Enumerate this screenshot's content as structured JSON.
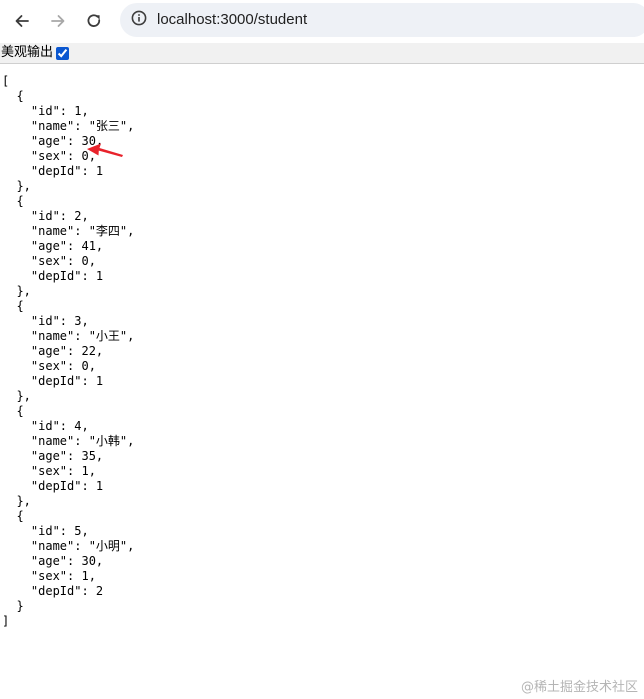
{
  "browser": {
    "url": "localhost:3000/student",
    "icons": {
      "back": "arrow-left-icon",
      "forward": "arrow-right-icon",
      "reload": "reload-icon",
      "site_info": "info-icon"
    }
  },
  "pretty_print": {
    "label": "美观输出",
    "checked": true
  },
  "json_lines": [
    "[",
    "  {",
    "    \"id\": 1,",
    "    \"name\": \"张三\",",
    "    \"age\": 30,",
    "    \"sex\": 0,",
    "    \"depId\": 1",
    "  },",
    "  {",
    "    \"id\": 2,",
    "    \"name\": \"李四\",",
    "    \"age\": 41,",
    "    \"sex\": 0,",
    "    \"depId\": 1",
    "  },",
    "  {",
    "    \"id\": 3,",
    "    \"name\": \"小王\",",
    "    \"age\": 22,",
    "    \"sex\": 0,",
    "    \"depId\": 1",
    "  },",
    "  {",
    "    \"id\": 4,",
    "    \"name\": \"小韩\",",
    "    \"age\": 35,",
    "    \"sex\": 1,",
    "    \"depId\": 1",
    "  },",
    "  {",
    "    \"id\": 5,",
    "    \"name\": \"小明\",",
    "    \"age\": 30,",
    "    \"sex\": 1,",
    "    \"depId\": 2",
    "  }",
    "]"
  ],
  "annotation": {
    "arrow_color": "#e8222b"
  },
  "watermark": "@稀土掘金技术社区"
}
